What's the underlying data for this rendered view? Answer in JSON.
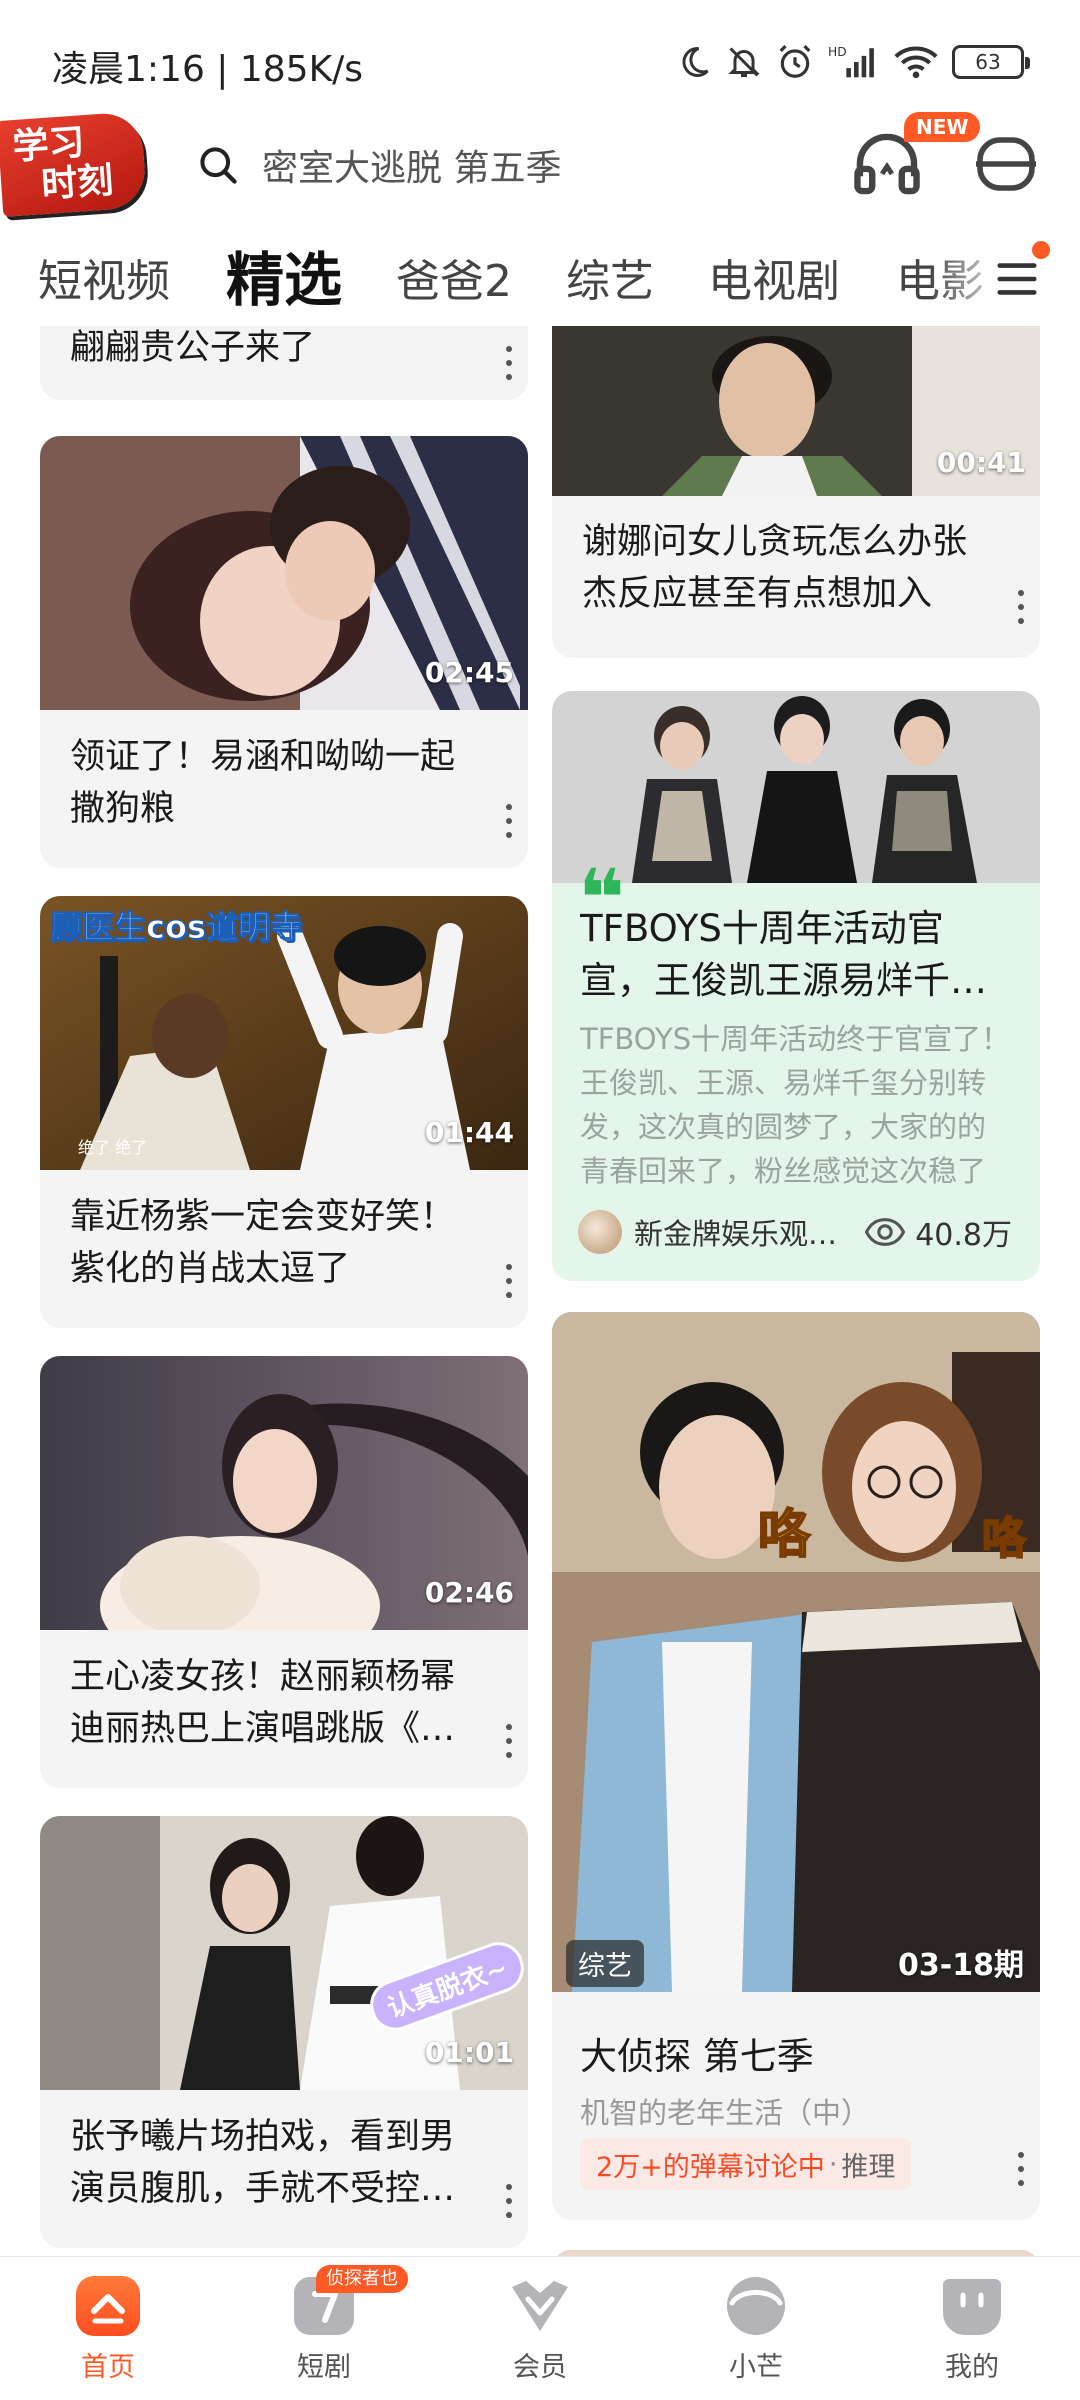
{
  "status_bar": {
    "time": "凌晨1:16 | 185K/s",
    "battery": "63"
  },
  "header": {
    "logo_line1": "学习",
    "logo_line2": "时刻",
    "search_placeholder": "密室大逃脱 第五季",
    "new_badge": "NEW"
  },
  "tabs": [
    "短视频",
    "精选",
    "爸爸2",
    "综艺",
    "电视剧",
    "电影"
  ],
  "active_tab": "精选",
  "feed": {
    "left": [
      {
        "title": "翩翩贵公子来了"
      },
      {
        "title": "领证了！易涵和呦呦一起撒狗粮",
        "duration": "02:45"
      },
      {
        "title": "靠近杨紫一定会变好笑！紫化的肖战太逗了",
        "duration": "01:44",
        "overlay_text": "顾医生cos道明寺",
        "overlay_sub": "绝了 绝了"
      },
      {
        "title": "王心凌女孩！赵丽颖杨幂迪丽热巴上演唱跳版《爱你》",
        "duration": "02:46"
      },
      {
        "title": "张予曦片场拍戏，看到男演员腹肌，手就不受控制了",
        "duration": "01:01",
        "sticker": "认真脱衣~"
      }
    ],
    "right": [
      {
        "title": "谢娜问女儿贪玩怎么办张杰反应甚至有点想加入",
        "duration": "00:41"
      },
      {
        "quote": "❝",
        "title": "TFBOYS十周年活动官宣，王俊凯王源易烊千玺分别转发",
        "summary": "TFBOYS十周年活动终于官宣了！王俊凯、王源、易烊千玺分别转发，这次真的圆梦了，大家的的青春回来了，粉丝感觉这次稳了",
        "author": "新金牌娱乐观察员",
        "views": "40.8万"
      },
      {
        "tag": "综艺",
        "episode": "03-18期",
        "title": "大侦探 第七季",
        "subtitle": "机智的老年生活（中）",
        "danmaku_hot": "2万+的弹幕讨论中",
        "danmaku_sep": "·",
        "danmaku_tag": "推理",
        "poster_text_left": "咯",
        "poster_text_right": "咯"
      }
    ]
  },
  "bottom_nav": {
    "items": [
      "首页",
      "短剧",
      "会员",
      "小芒",
      "我的"
    ],
    "active": "首页",
    "short_drama_badge": "侦探者也"
  },
  "colors": {
    "accent": "#ff5a26",
    "article_bg": "#e4f6ea",
    "quote_green": "#2fb55a",
    "card_bg": "#f4f4f4"
  }
}
